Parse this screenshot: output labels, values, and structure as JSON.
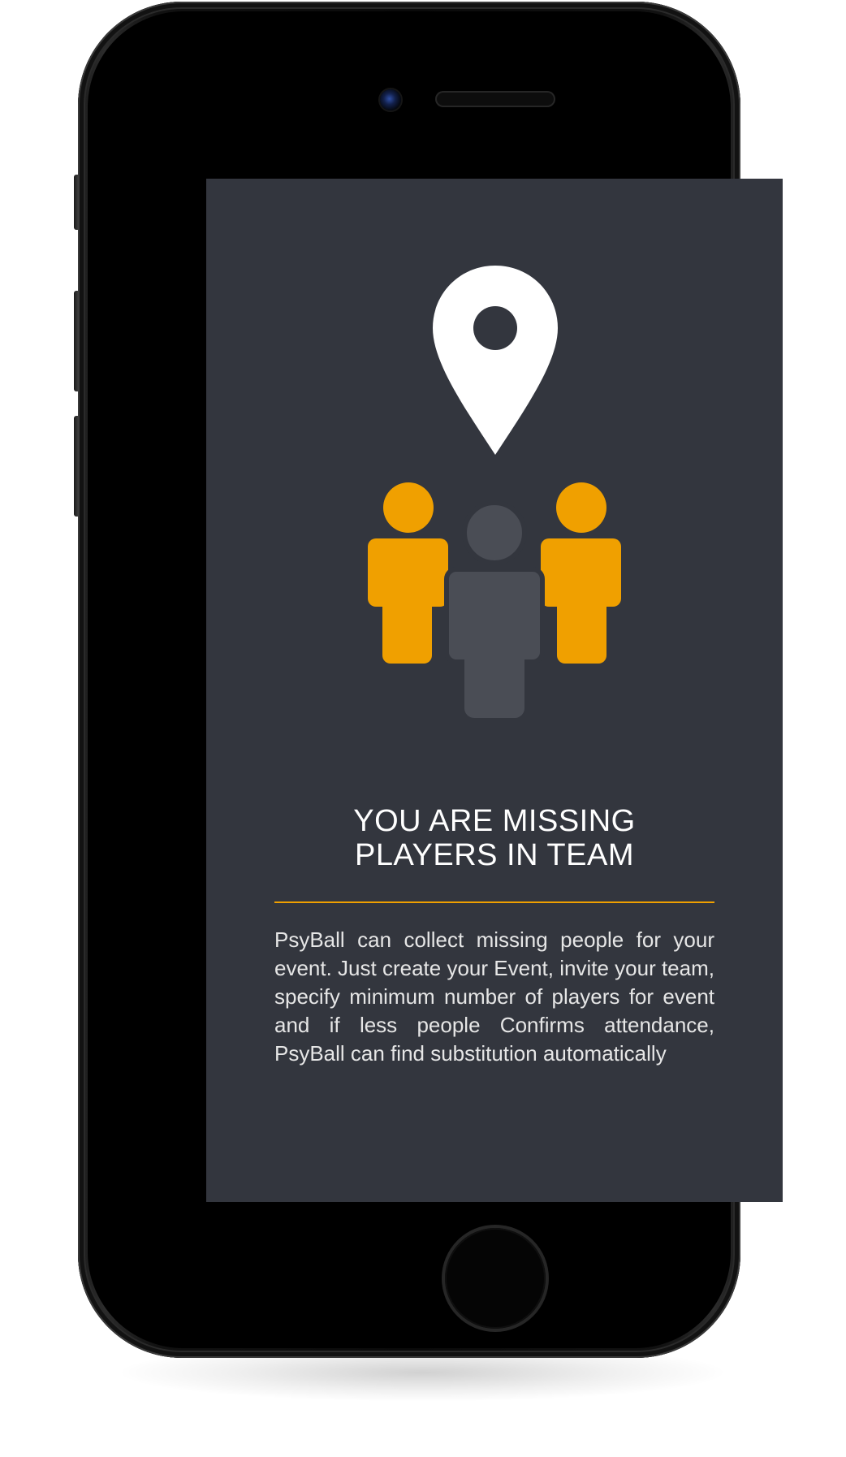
{
  "screen": {
    "title_lines": [
      "YOU ARE MISSING",
      "PLAYERS IN TEAM"
    ],
    "description": "PsyBall can collect missing people for your event. Just create your Event, invite your team, specify minimum number of players for event and if less people Confirms attendance, PsyBall can find substitution automatically"
  },
  "icons": {
    "pin": "location-pin-icon",
    "players": "team-players-icon"
  },
  "colors": {
    "screen_background": "#33363e",
    "accent": "#f0a000",
    "pin": "#ffffff",
    "missing_player": "#4a4d55",
    "title_text": "#ffffff",
    "body_text": "#e6e6e6"
  }
}
